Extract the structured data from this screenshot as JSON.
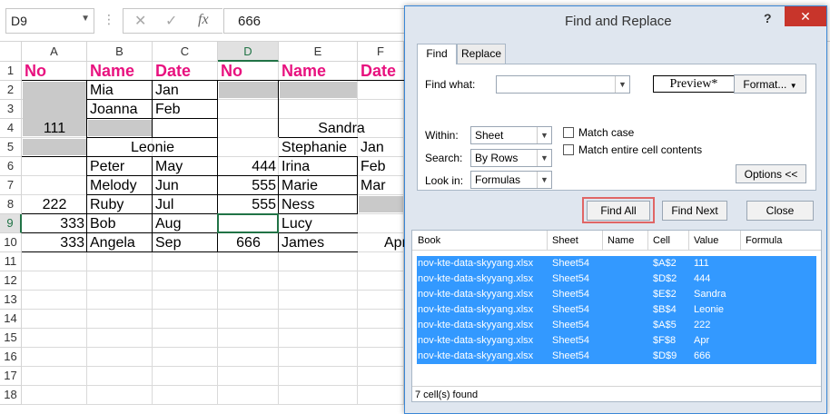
{
  "formula_bar": {
    "name_box": "D9",
    "formula": "666",
    "fx": "fx",
    "cancel": "✕",
    "enter": "✓"
  },
  "columns": [
    "A",
    "B",
    "C",
    "D",
    "E",
    "F"
  ],
  "rows": [
    "1",
    "2",
    "3",
    "4",
    "5",
    "6",
    "7",
    "8",
    "9",
    "10",
    "11",
    "12",
    "13",
    "14",
    "15",
    "16",
    "17",
    "18"
  ],
  "cells": {
    "A1": "No",
    "B1": "Name",
    "C1": "Date",
    "D1": "No",
    "E1": "Name",
    "F1": "Date",
    "B2": "Mia",
    "C2": "Jan",
    "B3": "Joanna",
    "C3": "Feb",
    "A4": "111",
    "E4": "Sandra",
    "B5": "Leonie",
    "E5": "Stephanie",
    "F5": "Jan",
    "B6": "Peter",
    "C6": "May",
    "D6": "444",
    "E6": "Irina",
    "F6": "Feb",
    "B7": "Melody",
    "C7": "Jun",
    "D7": "555",
    "E7": "Marie",
    "F7": "Mar",
    "A8": "222",
    "B8": "Ruby",
    "C8": "Jul",
    "D8": "555",
    "E8": "Ness",
    "A9": "333",
    "B9": "Bob",
    "C9": "Aug",
    "E9": "Lucy",
    "A10": "333",
    "B10": "Angela",
    "C10": "Sep",
    "D10": "666",
    "E10": "James",
    "F10": "Apr"
  },
  "dialog": {
    "title": "Find and Replace",
    "help": "?",
    "close": "✕",
    "tabs": [
      "Find",
      "Replace"
    ],
    "find_what_label": "Find what:",
    "find_what_value": "",
    "preview": "Preview*",
    "format_button": "Format...",
    "match_case": "Match case",
    "match_entire": "Match entire cell contents",
    "within_label": "Within:",
    "within_value": "Sheet",
    "search_label": "Search:",
    "search_value": "By Rows",
    "lookin_label": "Look in:",
    "lookin_value": "Formulas",
    "options_button": "Options <<",
    "find_all": "Find All",
    "find_next": "Find Next",
    "close_button": "Close",
    "results_headers": [
      "Book",
      "Sheet",
      "Name",
      "Cell",
      "Value",
      "Formula"
    ],
    "results": [
      {
        "book": "nov-kte-data-skyyang.xlsx",
        "sheet": "Sheet54",
        "name": "",
        "cell": "$A$2",
        "value": "111"
      },
      {
        "book": "nov-kte-data-skyyang.xlsx",
        "sheet": "Sheet54",
        "name": "",
        "cell": "$D$2",
        "value": "444"
      },
      {
        "book": "nov-kte-data-skyyang.xlsx",
        "sheet": "Sheet54",
        "name": "",
        "cell": "$E$2",
        "value": "Sandra"
      },
      {
        "book": "nov-kte-data-skyyang.xlsx",
        "sheet": "Sheet54",
        "name": "",
        "cell": "$B$4",
        "value": "Leonie"
      },
      {
        "book": "nov-kte-data-skyyang.xlsx",
        "sheet": "Sheet54",
        "name": "",
        "cell": "$A$5",
        "value": "222"
      },
      {
        "book": "nov-kte-data-skyyang.xlsx",
        "sheet": "Sheet54",
        "name": "",
        "cell": "$F$8",
        "value": "Apr"
      },
      {
        "book": "nov-kte-data-skyyang.xlsx",
        "sheet": "Sheet54",
        "name": "",
        "cell": "$D$9",
        "value": "666"
      }
    ],
    "status": "7 cell(s) found"
  },
  "colors": {
    "header_text": "#e8127f",
    "selection": "#217346",
    "result_highlight": "#3399ff",
    "find_all_outline": "#e06666"
  }
}
